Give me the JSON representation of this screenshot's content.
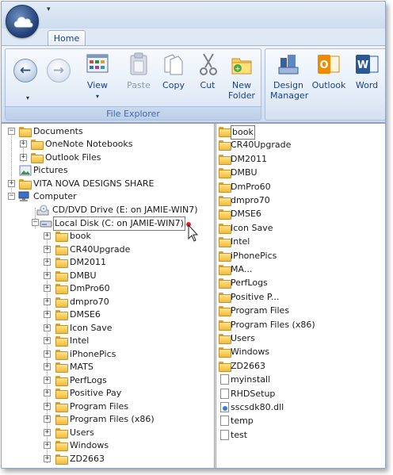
{
  "ribbon": {
    "tab_home": "Home",
    "group_file_explorer": "File Explorer",
    "buttons": {
      "back": "back",
      "forward": "forward",
      "view": "View",
      "paste": "Paste",
      "copy": "Copy",
      "cut": "Cut",
      "new_folder_line1": "New",
      "new_folder_line2": "Folder",
      "design_manager_line1": "Design",
      "design_manager_line2": "Manager",
      "outlook": "Outlook",
      "word": "Word"
    }
  },
  "tree": {
    "documents": "Documents",
    "onenote": "OneNote Notebooks",
    "outlook_files": "Outlook Files",
    "pictures": "Pictures",
    "vita_nova": "VITA NOVA DESIGNS SHARE",
    "computer": "Computer",
    "cd_drive": "CD/DVD Drive (E: on JAMIE-WIN7)",
    "local_disk": "Local Disk (C: on JAMIE-WIN7)",
    "disk_folders": [
      "book",
      "CR40Upgrade",
      "DM2011",
      "DMBU",
      "DmPro60",
      "dmpro70",
      "DMSE6",
      "Icon Save",
      "Intel",
      "iPhonePics",
      "MATS",
      "PerfLogs",
      "Positive Pay",
      "Program Files",
      "Program Files (x86)",
      "Users",
      "Windows",
      "ZD2663"
    ]
  },
  "list": {
    "folders": [
      "book",
      "CR40Upgrade",
      "DM2011",
      "DMBU",
      "DmPro60",
      "dmpro70",
      "DMSE6",
      "Icon Save",
      "Intel",
      "iPhonePics",
      "MA...",
      "PerfLogs",
      "Positive P...",
      "Program Files",
      "Program Files (x86)",
      "Users",
      "Windows",
      "ZD2663"
    ],
    "files": [
      {
        "name": "myinstall",
        "icon": "document-icon"
      },
      {
        "name": "RHDSetup",
        "icon": "document-icon"
      },
      {
        "name": "sscsdk80.dll",
        "icon": "dll-icon"
      },
      {
        "name": "temp",
        "icon": "document-icon"
      },
      {
        "name": "test",
        "icon": "document-icon"
      }
    ]
  },
  "colors": {
    "accent": "#15428b",
    "ribbon_bg": "#dce7f5",
    "folder": "#f0bb3b"
  }
}
